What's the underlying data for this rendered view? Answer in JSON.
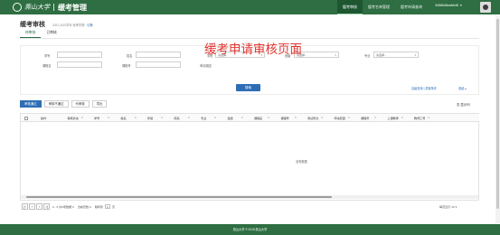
{
  "header": {
    "logo_text": "燕山大学",
    "app_title": "缓考管理",
    "nav": [
      "缓考审核",
      "缓考名单管理",
      "缓考申请查询"
    ],
    "user": "3456646eabb48",
    "colors": {
      "bar": "#2e6e42",
      "accent": "#2e6eb5"
    }
  },
  "page": {
    "title": "缓考审核",
    "subtitle": "2021-2022学年 秋季学期",
    "subtitle_link": "切换",
    "tabs": [
      "待审核",
      "已审核"
    ]
  },
  "overlay_note": "缓考申请审核页面",
  "filters": {
    "row1": [
      {
        "label": "学号",
        "value": ""
      },
      {
        "label": "姓名",
        "value": ""
      },
      {
        "label": "学院",
        "value": "请选择..."
      },
      {
        "label": "班级",
        "value": "请选择..."
      },
      {
        "label": "专业",
        "value": "请选择..."
      }
    ],
    "row2": [
      {
        "label": "课程名",
        "value": ""
      },
      {
        "label": "课程号",
        "value": ""
      },
      {
        "label": "申请原因",
        "value": ""
      }
    ],
    "search_label": "搜索",
    "advanced_link": "高级查询 | 重置条件",
    "collapse_link": "收起 ▴"
  },
  "toolbar": {
    "buttons": [
      "审核通过",
      "审核不通过",
      "代审核",
      "导出"
    ],
    "display_columns": "显示列"
  },
  "table": {
    "columns": [
      "操作",
      "审核状态",
      "学号",
      "姓名",
      "年级",
      "院系",
      "专业",
      "班级",
      "课程名",
      "课程号",
      "考试周次",
      "申请原因",
      "课程号",
      "上课教师",
      "教师工号"
    ],
    "empty_text": "没有数据"
  },
  "pager": {
    "summary": "0 - 0 共0项数据 0",
    "selected_label": "当前页数 0",
    "goto_label": "跳转到",
    "page_value": "1",
    "page_unit": "页",
    "page_size_label": "每页显示",
    "page_size": "20"
  },
  "footer": {
    "text": "燕山大学 © 2018 燕山大学"
  }
}
